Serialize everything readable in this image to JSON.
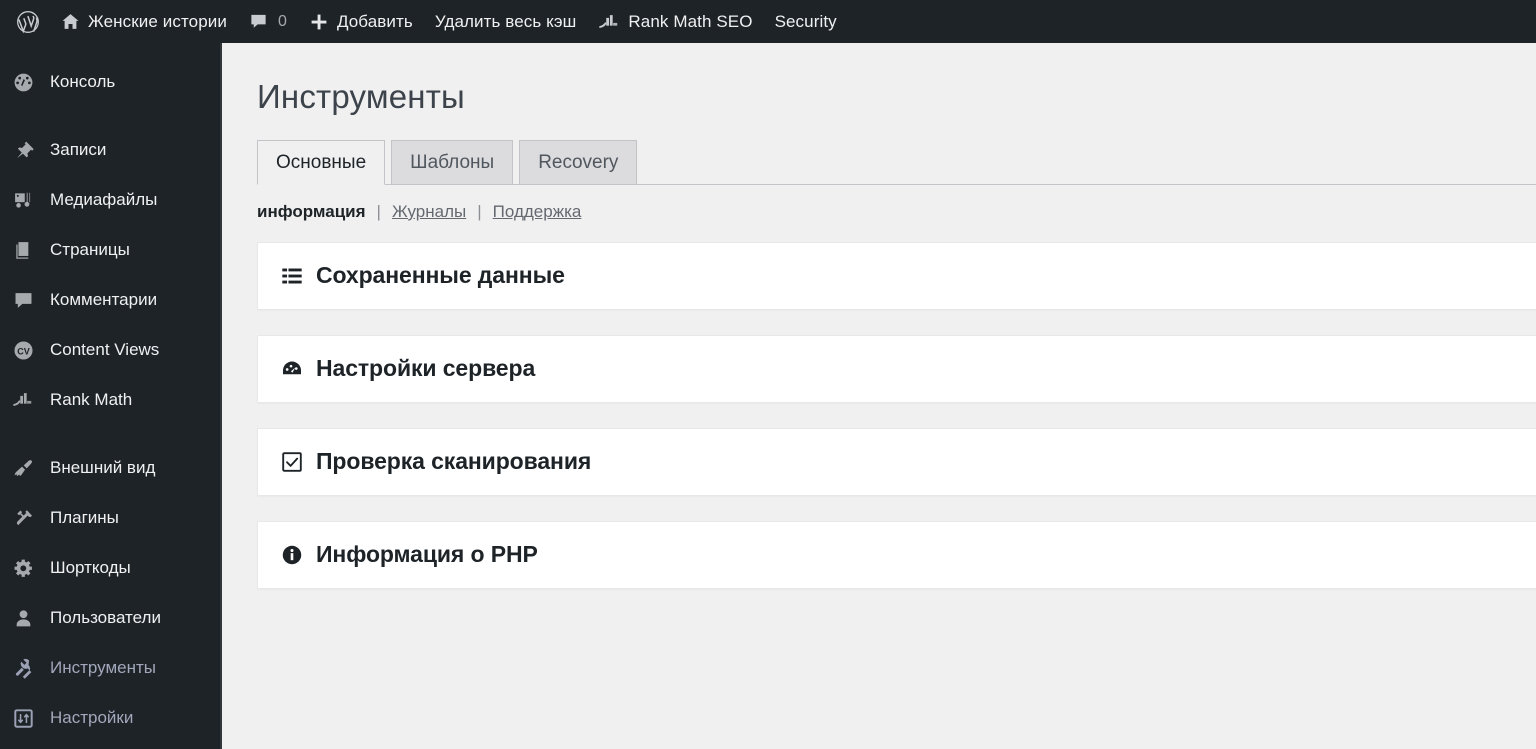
{
  "adminbar": {
    "logo": "wordpress-logo",
    "items": [
      {
        "label": "Женские истории",
        "icon": "home-icon"
      },
      {
        "label": "0",
        "icon": "comment-icon",
        "is_count": true
      },
      {
        "label": "Добавить",
        "icon": "plus-icon"
      },
      {
        "label": "Удалить весь кэш",
        "icon": ""
      },
      {
        "label": "Rank Math SEO",
        "icon": "rank-math-icon"
      },
      {
        "label": "Security",
        "icon": ""
      }
    ]
  },
  "sidebar": {
    "items": [
      {
        "label": "Консоль",
        "icon": "dashboard-icon",
        "current": false,
        "separator_before": false
      },
      {
        "label": "Записи",
        "icon": "pin-icon",
        "current": false,
        "separator_before": true
      },
      {
        "label": "Медиафайлы",
        "icon": "media-icon",
        "current": false,
        "separator_before": false
      },
      {
        "label": "Страницы",
        "icon": "pages-icon",
        "current": false,
        "separator_before": false
      },
      {
        "label": "Комментарии",
        "icon": "comment-icon",
        "current": false,
        "separator_before": false
      },
      {
        "label": "Content Views",
        "icon": "content-views-icon",
        "current": false,
        "separator_before": false
      },
      {
        "label": "Rank Math",
        "icon": "rank-math-icon",
        "current": false,
        "separator_before": false
      },
      {
        "label": "Внешний вид",
        "icon": "appearance-icon",
        "current": false,
        "separator_before": true
      },
      {
        "label": "Плагины",
        "icon": "plugins-icon",
        "current": false,
        "separator_before": false
      },
      {
        "label": "Шорткоды",
        "icon": "gear-icon",
        "current": false,
        "separator_before": false
      },
      {
        "label": "Пользователи",
        "icon": "users-icon",
        "current": false,
        "separator_before": false
      },
      {
        "label": "Инструменты",
        "icon": "wrench-icon",
        "current": true,
        "separator_before": false
      },
      {
        "label": "Настройки",
        "icon": "settings-icon",
        "current": true,
        "separator_before": false
      }
    ]
  },
  "main": {
    "page_title": "Инструменты",
    "tabs": [
      {
        "label": "Основные",
        "active": true
      },
      {
        "label": "Шаблоны",
        "active": false
      },
      {
        "label": "Recovery",
        "active": false
      }
    ],
    "subnav": {
      "current": "информация",
      "separator": "|",
      "links": [
        "Журналы",
        "Поддержка"
      ]
    },
    "panels": [
      {
        "title": "Сохраненные данные",
        "icon": "list-view-icon"
      },
      {
        "title": "Настройки сервера",
        "icon": "gauge-icon"
      },
      {
        "title": "Проверка сканирования",
        "icon": "checkbox-icon"
      },
      {
        "title": "Информация о PHP",
        "icon": "info-icon"
      }
    ]
  },
  "colors": {
    "adminbar_bg": "#1d2327",
    "sidebar_bg": "#1d2327",
    "content_bg": "#f0f0f1",
    "panel_bg": "#ffffff",
    "current_menu": "#a3a7bb",
    "tab_inactive_bg": "#dcdcde"
  }
}
